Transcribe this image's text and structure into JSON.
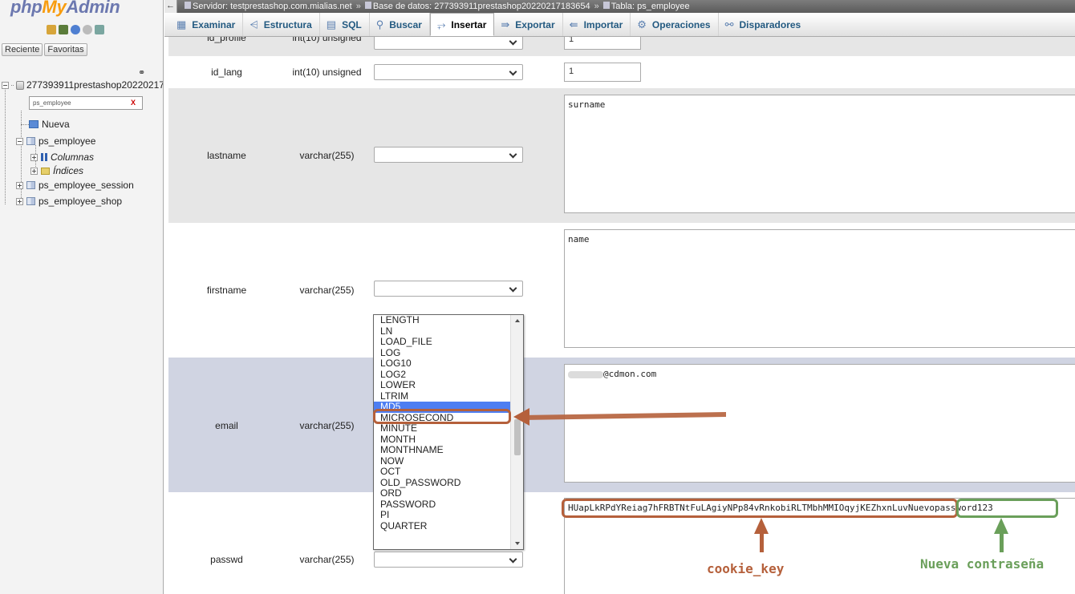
{
  "nav": {
    "logo_php": "php",
    "logo_my": "My",
    "logo_admin": "Admin",
    "icons": [
      "home-icon",
      "database-icon",
      "help-icon",
      "docs-icon",
      "settings-icon"
    ],
    "recent_tab": "Reciente",
    "favorites_tab": "Favoritas",
    "database": "277393911prestashop20220217183654",
    "filter_value": "ps_employee",
    "filter_clear": "X",
    "new_item": "Nueva",
    "table_main": "ps_employee",
    "columns": "Columnas",
    "indexes": "Índices",
    "table_session": "ps_employee_session",
    "table_shop": "ps_employee_shop"
  },
  "breadcrumb": {
    "collapse": "←",
    "server": "Servidor: testprestashop.com.mialias.net",
    "sep": "»",
    "database": "Base de datos: 277393911prestashop20220217183654",
    "table": "Tabla: ps_employee"
  },
  "tabs": [
    {
      "label": "Examinar",
      "icon": "▦"
    },
    {
      "label": "Estructura",
      "icon": "⩤"
    },
    {
      "label": "SQL",
      "icon": "▤"
    },
    {
      "label": "Buscar",
      "icon": "⚲"
    },
    {
      "label": "Insertar",
      "icon": "⥅"
    },
    {
      "label": "Exportar",
      "icon": "⇛"
    },
    {
      "label": "Importar",
      "icon": "⇚"
    },
    {
      "label": "Operaciones",
      "icon": "⚙"
    },
    {
      "label": "Disparadores",
      "icon": "⚯"
    }
  ],
  "rows": {
    "id_profile": {
      "name": "id_profile",
      "type": "int(10) unsigned",
      "value": "1"
    },
    "id_lang": {
      "name": "id_lang",
      "type": "int(10) unsigned",
      "value": "1"
    },
    "lastname": {
      "name": "lastname",
      "type": "varchar(255)",
      "value": "surname"
    },
    "firstname": {
      "name": "firstname",
      "type": "varchar(255)",
      "value": "name"
    },
    "email": {
      "name": "email",
      "type": "varchar(255)",
      "value": "@cdmon.com"
    },
    "passwd": {
      "name": "passwd",
      "type": "varchar(255)",
      "cookie_key": "HUapLkRPdYReiag7hFRBTNtFuLAgiyNPp84vRnkobiRLTMbhMMIOqyjKEZhxnLuv",
      "new_password": "Nuevopassword123"
    }
  },
  "dropdown_options": [
    "LENGTH",
    "LN",
    "LOAD_FILE",
    "LOG",
    "LOG10",
    "LOG2",
    "LOWER",
    "LTRIM",
    "MD5",
    "MICROSECOND",
    "MINUTE",
    "MONTH",
    "MONTHNAME",
    "NOW",
    "OCT",
    "OLD_PASSWORD",
    "ORD",
    "PASSWORD",
    "PI",
    "QUARTER"
  ],
  "dropdown_selected": "MD5",
  "annotations": {
    "cookie_key_label": "cookie_key",
    "new_password_label": "Nueva contraseña",
    "orange": "#b5603b",
    "green": "#6a9f5a"
  }
}
